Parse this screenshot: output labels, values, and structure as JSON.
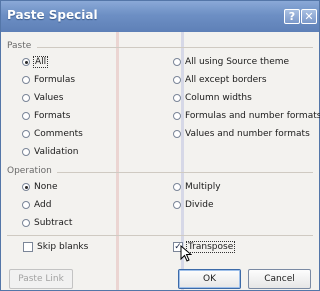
{
  "window": {
    "title": "Paste Special",
    "help_glyph": "?",
    "close_glyph": "✕"
  },
  "paste": {
    "label": "Paste",
    "left": [
      "All",
      "Formulas",
      "Values",
      "Formats",
      "Comments",
      "Validation"
    ],
    "right": [
      "All using Source theme",
      "All except borders",
      "Column widths",
      "Formulas and number formats",
      "Values and number formats"
    ],
    "selected": "All"
  },
  "operation": {
    "label": "Operation",
    "left": [
      "None",
      "Add",
      "Subtract"
    ],
    "right": [
      "Multiply",
      "Divide"
    ],
    "selected": "None"
  },
  "checks": {
    "skip_blanks": "Skip blanks",
    "skip_blanks_checked": false,
    "transpose": "Transpose",
    "transpose_checked": true
  },
  "buttons": {
    "paste_link": "Paste Link",
    "ok": "OK",
    "cancel": "Cancel"
  },
  "colors": {
    "titlebar": "#6d8fc4",
    "client_bg": "#f3f2ef"
  },
  "icons": {
    "check": "✓",
    "cursor": "arrow-pointer-icon"
  }
}
